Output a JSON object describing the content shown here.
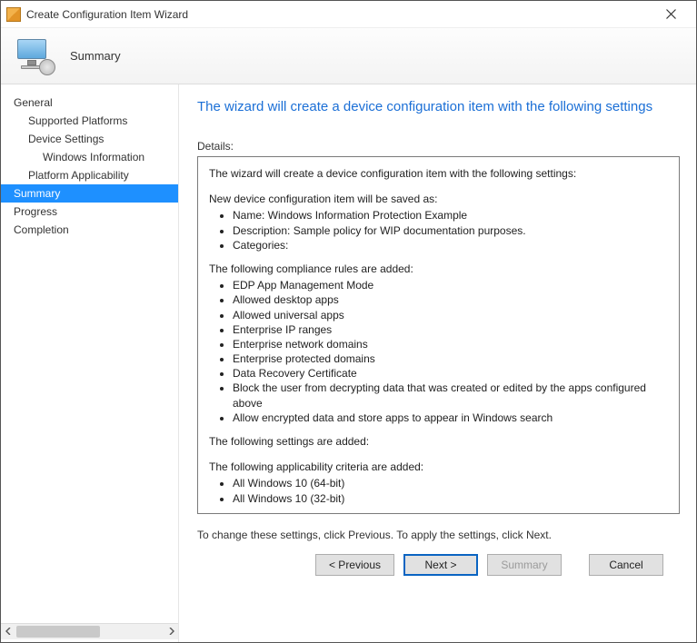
{
  "window": {
    "title": "Create Configuration Item Wizard"
  },
  "header": {
    "label": "Summary"
  },
  "nav": {
    "items": [
      {
        "label": "General",
        "indent": 0
      },
      {
        "label": "Supported Platforms",
        "indent": 1
      },
      {
        "label": "Device Settings",
        "indent": 1
      },
      {
        "label": "Windows Information",
        "indent": 2
      },
      {
        "label": "Platform Applicability",
        "indent": 1
      },
      {
        "label": "Summary",
        "indent": 0,
        "selected": true
      },
      {
        "label": "Progress",
        "indent": 0
      },
      {
        "label": "Completion",
        "indent": 0
      }
    ]
  },
  "main": {
    "heading": "The wizard will create a device configuration item with the following settings",
    "details_label": "Details:",
    "intro": "The wizard will create a device configuration item with the following settings:",
    "saved_as_label": "New device configuration item will be saved as:",
    "saved_as": [
      "Name: Windows Information Protection Example",
      "Description: Sample policy for WIP documentation purposes.",
      "Categories:"
    ],
    "rules_label": "The following compliance rules are added:",
    "rules": [
      "EDP App Management Mode",
      "Allowed desktop apps",
      "Allowed universal apps",
      "Enterprise IP ranges",
      "Enterprise network domains",
      "Enterprise protected domains",
      "Data Recovery Certificate",
      "Block the user from decrypting data that was created or edited by the apps configured above",
      "Allow encrypted data and store apps to appear in Windows search"
    ],
    "settings_label": "The following settings are added:",
    "applicability_label": "The following applicability criteria are added:",
    "applicability": [
      "All Windows 10 (64-bit)",
      "All Windows 10 (32-bit)"
    ],
    "hint": "To change these settings, click Previous. To apply the settings, click Next."
  },
  "footer": {
    "previous": "< Previous",
    "next": "Next >",
    "summary": "Summary",
    "cancel": "Cancel"
  }
}
